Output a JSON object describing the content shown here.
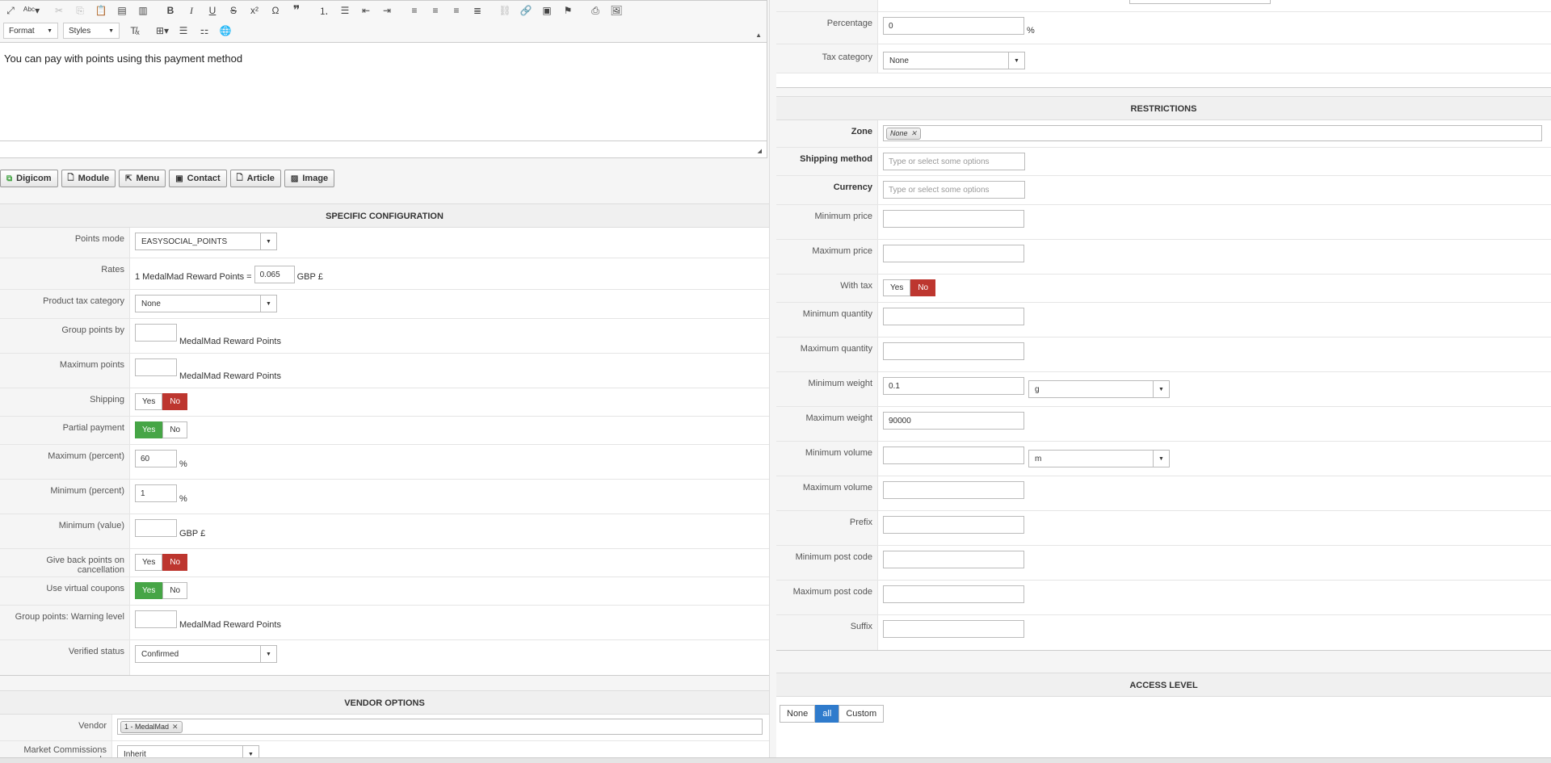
{
  "editor": {
    "format_label": "Format",
    "styles_label": "Styles",
    "content": "You can pay with points using this payment method"
  },
  "plugins": [
    {
      "label": "Digicom",
      "icon": "digicom-icon"
    },
    {
      "label": "Module",
      "icon": "module-icon"
    },
    {
      "label": "Menu",
      "icon": "menu-icon"
    },
    {
      "label": "Contact",
      "icon": "contact-icon"
    },
    {
      "label": "Article",
      "icon": "article-icon"
    },
    {
      "label": "Image",
      "icon": "image-icon"
    }
  ],
  "specific": {
    "title": "SPECIFIC CONFIGURATION",
    "points_mode_label": "Points mode",
    "points_mode_value": "EASYSOCIAL_POINTS",
    "rates_label": "Rates",
    "rates_prefix": "1 MedalMad Reward Points =",
    "rates_value": "0.065",
    "rates_unit": "GBP £",
    "product_tax_label": "Product tax category",
    "product_tax_value": "None",
    "group_points_label": "Group points by",
    "group_points_unit": "MedalMad Reward Points",
    "max_points_label": "Maximum points",
    "max_points_unit": "MedalMad Reward Points",
    "shipping_label": "Shipping",
    "partial_label": "Partial payment",
    "max_percent_label": "Maximum (percent)",
    "max_percent_value": "60",
    "min_percent_label": "Minimum (percent)",
    "min_percent_value": "1",
    "percent_unit": "%",
    "min_value_label": "Minimum (value)",
    "min_value_unit": "GBP £",
    "give_back_label": "Give back points on cancellation",
    "virtual_coupons_label": "Use virtual coupons",
    "warning_label": "Group points: Warning level",
    "warning_unit": "MedalMad Reward Points",
    "verified_label": "Verified status",
    "verified_value": "Confirmed",
    "yes": "Yes",
    "no": "No"
  },
  "vendor": {
    "title": "VENDOR OPTIONS",
    "vendor_label": "Vendor",
    "vendor_chip": "1 - MedalMad",
    "commission_label": "Market Commissions mode",
    "commission_value": "Inherit"
  },
  "top_right": {
    "percentage_label": "Percentage",
    "percentage_value": "0",
    "percentage_unit": "%",
    "tax_category_label": "Tax category",
    "tax_category_value": "None"
  },
  "restrictions": {
    "title": "RESTRICTIONS",
    "zone_label": "Zone",
    "zone_chip": "None",
    "shipping_method_label": "Shipping method",
    "shipping_method_placeholder": "Type or select some options",
    "currency_label": "Currency",
    "currency_placeholder": "Type or select some options",
    "min_price_label": "Minimum price",
    "max_price_label": "Maximum price",
    "with_tax_label": "With tax",
    "min_qty_label": "Minimum quantity",
    "max_qty_label": "Maximum quantity",
    "min_weight_label": "Minimum weight",
    "min_weight_value": "0.1",
    "weight_unit": "g",
    "max_weight_label": "Maximum weight",
    "max_weight_value": "90000",
    "min_volume_label": "Minimum volume",
    "volume_unit": "m",
    "max_volume_label": "Maximum volume",
    "prefix_label": "Prefix",
    "min_post_label": "Minimum post code",
    "max_post_label": "Maximum post code",
    "suffix_label": "Suffix",
    "yes": "Yes",
    "no": "No"
  },
  "access": {
    "title": "ACCESS LEVEL",
    "none": "None",
    "all": "all",
    "custom": "Custom"
  }
}
